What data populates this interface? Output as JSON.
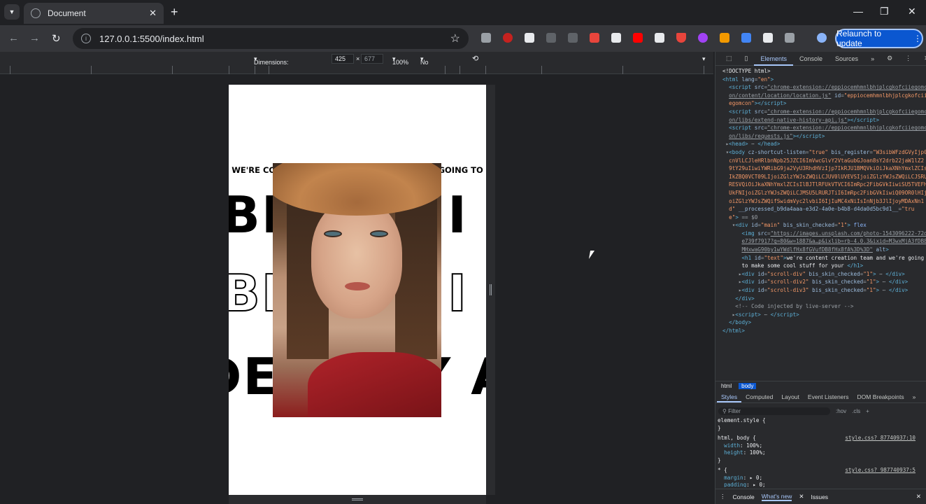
{
  "browser": {
    "tab_title": "Document",
    "url": "127.0.0.1:5500/index.html",
    "relaunch_label": "Relaunch to update",
    "window_controls": [
      "—",
      "❐",
      "✕"
    ]
  },
  "devicebar": {
    "dimensions_label": "Dimensions: Responsive",
    "width": "425",
    "height": "677",
    "zoom": "100%",
    "throttling": "No throttling"
  },
  "page": {
    "headline": "WE'RE CONTENT CREATION TEAM AND WE'RE GOING TO MAKE SOME COOL STUFF FOR YOUR",
    "big_row1": "BRAND I",
    "big_row2": "BRAND I",
    "big_row3": "IDENTITY AN",
    "photo_alt": ""
  },
  "devtools": {
    "tabs": [
      "Elements",
      "Console",
      "Sources",
      "»"
    ],
    "crumbs": [
      "html",
      "body"
    ],
    "styles_tabs": [
      "Styles",
      "Computed",
      "Layout",
      "Event Listeners",
      "DOM Breakpoints",
      "»"
    ],
    "filter_placeholder": "Filter",
    "filter_hov": ":hov",
    "filter_cls": ".cls",
    "drawer_tabs": [
      "Console",
      "What's new",
      "Issues"
    ],
    "style_src1": "style.css?_87740937:10",
    "style_src2": "style.css?_987740937:5"
  },
  "colors": {
    "accent": "#0b57d0",
    "page_bg": "#ffffff",
    "chrome_bg": "#202124"
  },
  "icons": {
    "tab_menu": "chevron-down-icon",
    "reload": "reload-icon",
    "star": "star-icon"
  }
}
